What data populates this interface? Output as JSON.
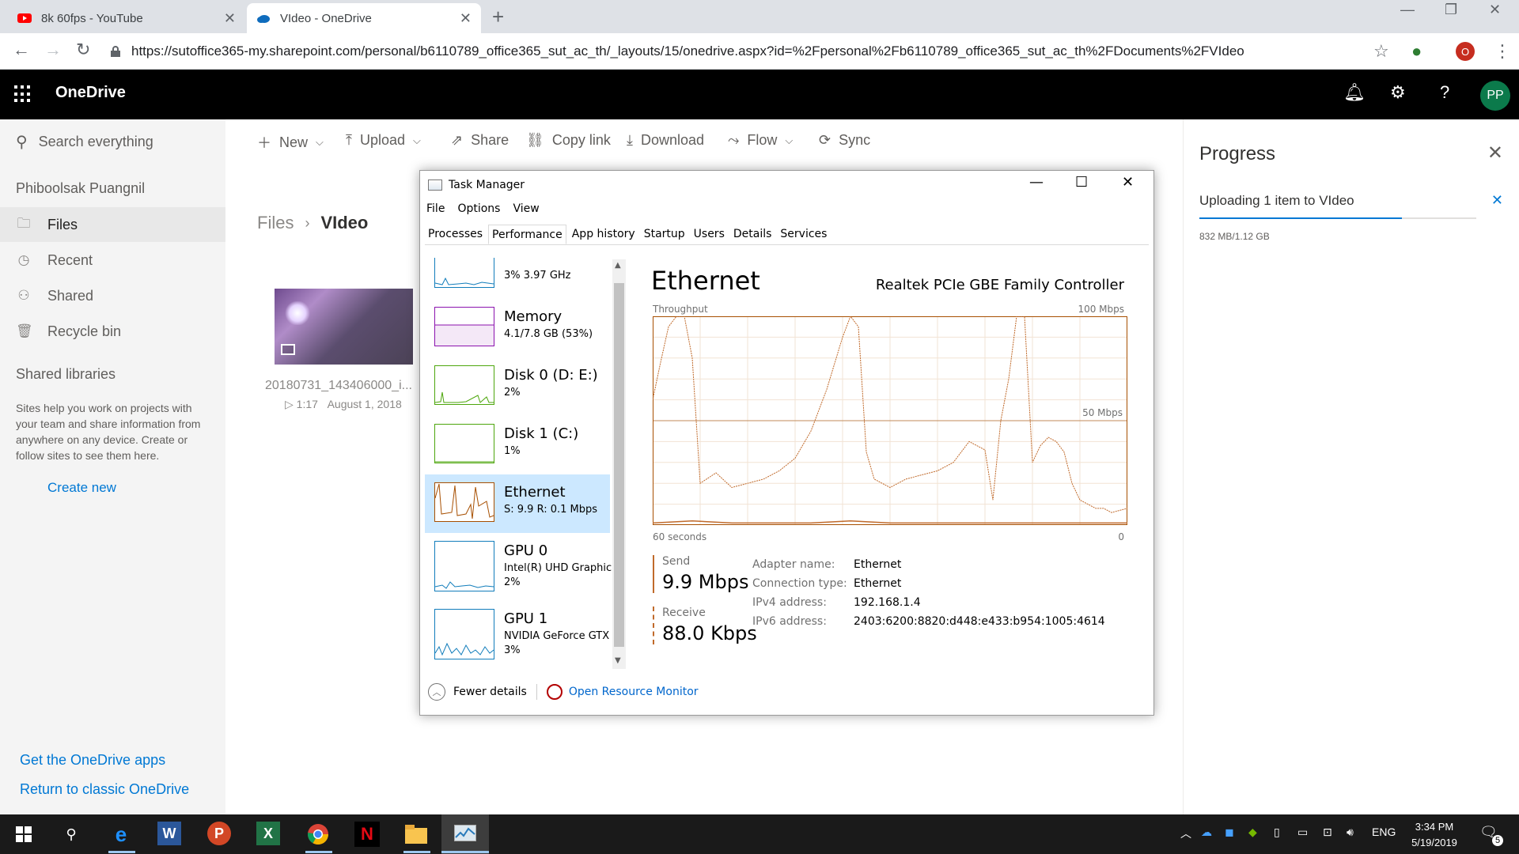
{
  "browser": {
    "tabs": [
      {
        "title": "8k 60fps - YouTube",
        "close": "✕"
      },
      {
        "title": "VIdeo - OneDrive",
        "close": "✕"
      }
    ],
    "new_tab": "+",
    "url_host": "https://sutoffice365-my.sharepoint.com",
    "url_path": "/personal/b6110789_office365_sut_ac_th/_layouts/15/onedrive.aspx?id=%2Fpersonal%2Fb6110789_office365_sut_ac_th%2FDocuments%2FVIdeo",
    "extension_badge": "O"
  },
  "onedrive": {
    "title": "OneDrive",
    "avatar": "PP",
    "help": "?"
  },
  "nav": {
    "search_placeholder": "Search everything",
    "user": "Phiboolsak Puangnil",
    "items": [
      {
        "label": "Files",
        "icon": "folder-icon"
      },
      {
        "label": "Recent",
        "icon": "clock-icon"
      },
      {
        "label": "Shared",
        "icon": "people-icon"
      },
      {
        "label": "Recycle bin",
        "icon": "trash-icon"
      }
    ],
    "shared_libraries": "Shared libraries",
    "shared_help": "Sites help you work on projects with your team and share information from anywhere on any device. Create or follow sites to see them here.",
    "create_new": "Create new",
    "get_apps": "Get the OneDrive apps",
    "return_classic": "Return to classic OneDrive"
  },
  "commands": {
    "new": "New",
    "upload": "Upload",
    "share": "Share",
    "copy_link": "Copy link",
    "download": "Download",
    "flow": "Flow",
    "sync": "Sync"
  },
  "content": {
    "breadcrumb_root": "Files",
    "breadcrumb_current": "VIdeo",
    "file_name": "20180731_143406000_i...",
    "file_duration": "1:17",
    "file_date": "August 1, 2018"
  },
  "progress": {
    "title": "Progress",
    "item": "Uploading 1 item to VIdeo",
    "size": "832 MB/1.12 GB",
    "fraction": 0.73
  },
  "taskmgr": {
    "title": "Task Manager",
    "menu": [
      "File",
      "Options",
      "View"
    ],
    "tabs": [
      "Processes",
      "Performance",
      "App history",
      "Startup",
      "Users",
      "Details",
      "Services"
    ],
    "resources": [
      {
        "name": "",
        "sub1": "3% 3.97 GHz",
        "sub2": ""
      },
      {
        "name": "Memory",
        "sub1": "4.1/7.8 GB (53%)",
        "sub2": ""
      },
      {
        "name": "Disk 0 (D: E:)",
        "sub1": "2%",
        "sub2": ""
      },
      {
        "name": "Disk 1 (C:)",
        "sub1": "1%",
        "sub2": ""
      },
      {
        "name": "Ethernet",
        "sub1": "S: 9.9 R: 0.1 Mbps",
        "sub2": ""
      },
      {
        "name": "GPU 0",
        "sub1": "Intel(R) UHD Graphic",
        "sub2": "2%"
      },
      {
        "name": "GPU 1",
        "sub1": "NVIDIA GeForce GTX",
        "sub2": "3%"
      }
    ],
    "ethernet": {
      "name": "Ethernet",
      "controller": "Realtek PCIe GBE Family Controller",
      "throughput_label": "Throughput",
      "max_label": "100 Mbps",
      "mid_label": "50 Mbps",
      "time_left": "60 seconds",
      "time_right": "0",
      "send_label": "Send",
      "send_value": "9.9 Mbps",
      "receive_label": "Receive",
      "receive_value": "88.0 Kbps",
      "props": [
        {
          "k": "Adapter name:",
          "v": "Ethernet"
        },
        {
          "k": "Connection type:",
          "v": "Ethernet"
        },
        {
          "k": "IPv4 address:",
          "v": "192.168.1.4"
        },
        {
          "k": "IPv6 address:",
          "v": "2403:6200:8820:d448:e433:b954:1005:4614"
        }
      ]
    },
    "fewer_details": "Fewer details",
    "open_resource_monitor": "Open Resource Monitor"
  },
  "taskbar": {
    "lang": "ENG",
    "time": "3:34 PM",
    "date": "5/19/2019",
    "notifications": "5"
  },
  "chart_data": {
    "type": "line",
    "title": "Throughput",
    "ylabel": "",
    "xlabel": "60 seconds",
    "ylim": [
      0,
      100
    ],
    "xlim": [
      60,
      0
    ],
    "series": [
      {
        "name": "Send",
        "x": [
          60,
          59,
          58,
          57,
          56,
          55,
          54,
          52,
          50,
          48,
          46,
          44,
          42,
          40,
          38,
          36,
          35,
          34,
          33,
          32,
          31,
          30,
          29,
          28,
          26,
          24,
          22,
          20,
          18,
          17,
          16,
          15,
          14,
          13,
          12,
          11,
          10,
          9,
          8,
          7,
          6,
          5,
          4,
          3,
          2,
          1,
          0
        ],
        "values": [
          60,
          78,
          95,
          100,
          100,
          80,
          20,
          25,
          18,
          20,
          22,
          26,
          32,
          45,
          65,
          90,
          100,
          95,
          35,
          22,
          20,
          18,
          20,
          22,
          24,
          26,
          30,
          40,
          36,
          12,
          50,
          70,
          100,
          100,
          30,
          38,
          42,
          40,
          35,
          20,
          12,
          10,
          8,
          8,
          6,
          7,
          8
        ]
      },
      {
        "name": "Receive",
        "x": [
          60,
          55,
          50,
          45,
          40,
          35,
          30,
          25,
          20,
          15,
          10,
          5,
          0
        ],
        "values": [
          1,
          2,
          1,
          1,
          1,
          2,
          1,
          1,
          1,
          1,
          1,
          1,
          1
        ]
      }
    ]
  }
}
